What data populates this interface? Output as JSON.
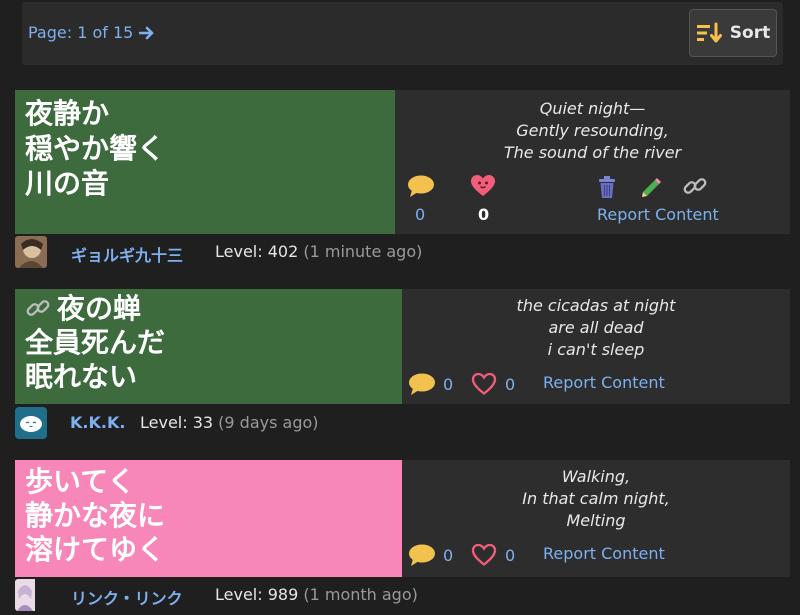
{
  "pagination": {
    "label": "Page: 1 of 15"
  },
  "sort": {
    "label": "Sort"
  },
  "colors": {
    "green": "#3d6b3e",
    "pink": "#f687b8",
    "link": "#7eb0ef",
    "panel": "#2d2d2d"
  },
  "posts": [
    {
      "haiku": [
        "夜静か",
        "穏やか響く",
        "川の音"
      ],
      "translation": [
        "Quiet night—",
        "Gently resounding,",
        "The sound of the river"
      ],
      "comments": "0",
      "likes": "0",
      "report": "Report Content",
      "user": "ギョルギ九十三",
      "level_label": "Level: 402",
      "ago": "(1 minute ago)"
    },
    {
      "haiku": [
        "夜の蝉",
        "全員死んだ",
        "眠れない"
      ],
      "translation": [
        "the cicadas at night",
        "are all dead",
        "i can't sleep"
      ],
      "comments": "0",
      "likes": "0",
      "report": "Report Content",
      "user": "K.K.K.",
      "level_label": "Level: 33",
      "ago": "(9 days ago)"
    },
    {
      "haiku": [
        "歩いてく",
        "静かな夜に",
        "溶けてゆく"
      ],
      "translation": [
        "Walking,",
        "In that calm night,",
        "Melting"
      ],
      "comments": "0",
      "likes": "0",
      "report": "Report Content",
      "user": "リンク・リンク",
      "level_label": "Level: 989",
      "ago": "(1 month ago)"
    }
  ]
}
